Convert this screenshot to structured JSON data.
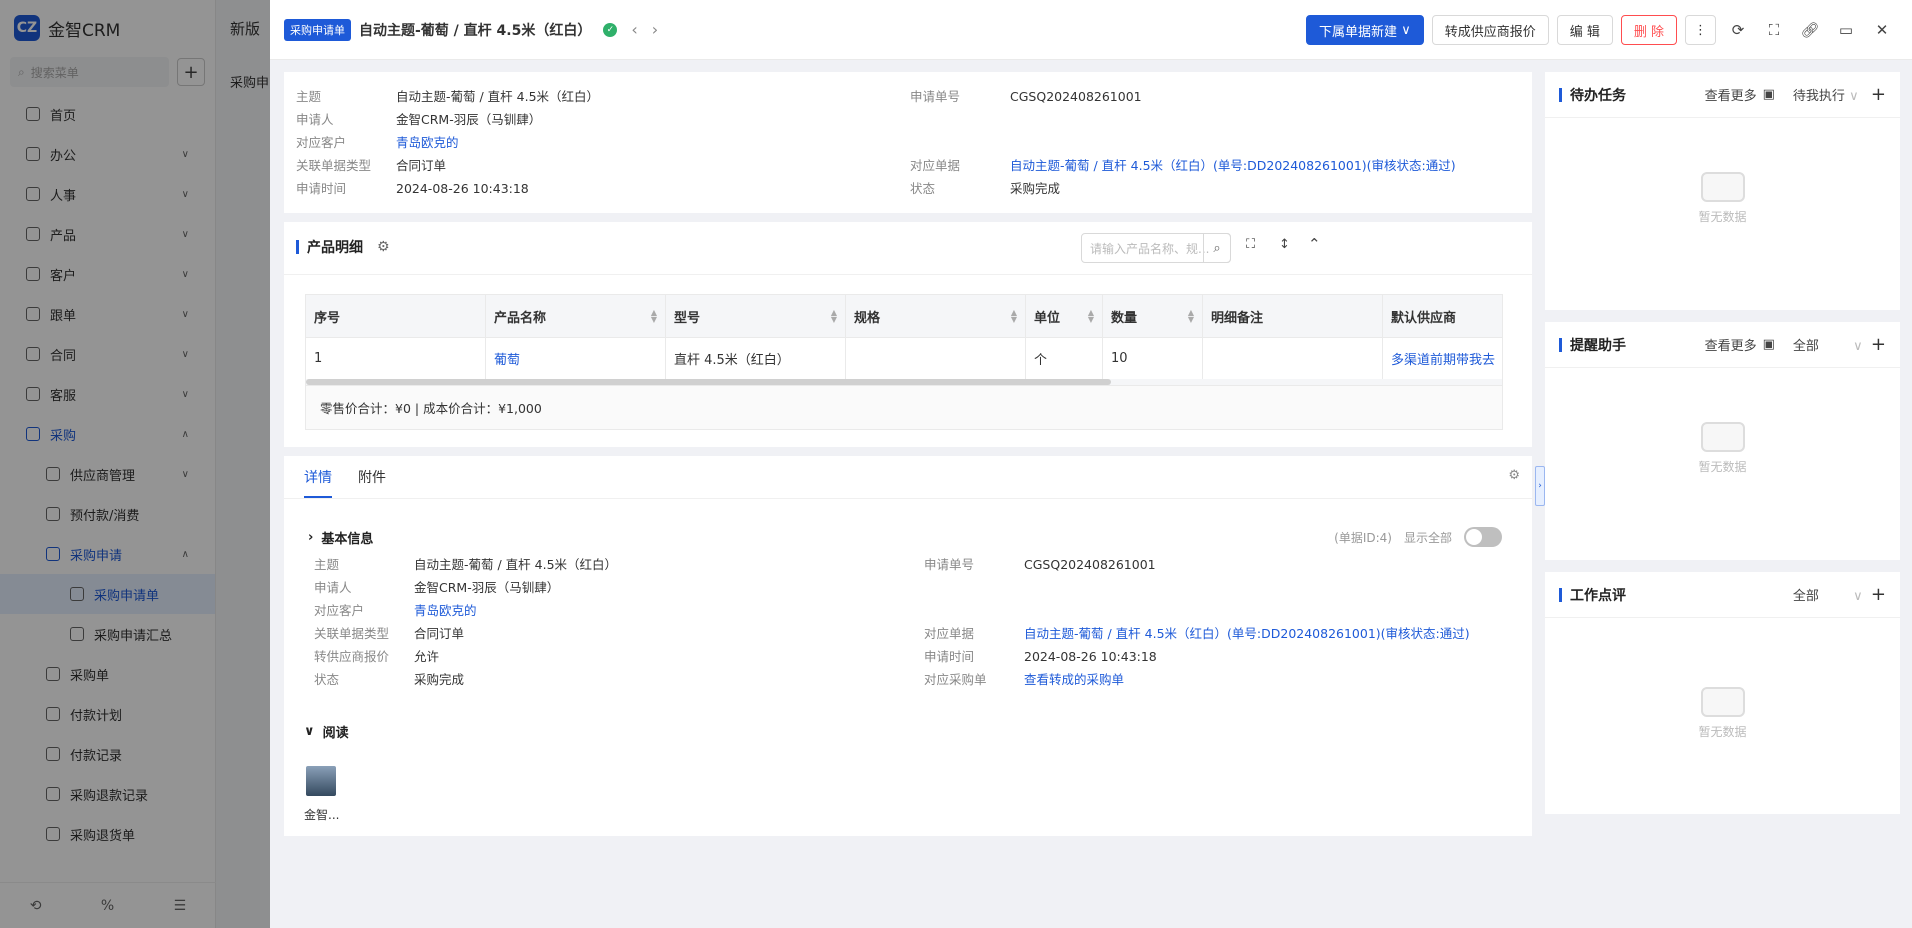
{
  "app": {
    "logo_text": "金智CRM",
    "logo_mark": "CZ",
    "search_placeholder": "搜索菜单",
    "mid_tab": "新版",
    "mid_sub": "采购申"
  },
  "menu": [
    {
      "label": "首页"
    },
    {
      "label": "办公"
    },
    {
      "label": "人事"
    },
    {
      "label": "产品"
    },
    {
      "label": "客户"
    },
    {
      "label": "跟单"
    },
    {
      "label": "合同"
    },
    {
      "label": "客服"
    },
    {
      "label": "采购"
    },
    {
      "label": "供应商管理"
    },
    {
      "label": "预付款/消费"
    },
    {
      "label": "采购申请"
    },
    {
      "label": "采购申请单"
    },
    {
      "label": "采购申请汇总"
    },
    {
      "label": "采购单"
    },
    {
      "label": "付款计划"
    },
    {
      "label": "付款记录"
    },
    {
      "label": "采购退款记录"
    },
    {
      "label": "采购退货单"
    }
  ],
  "topbar": {
    "badge": "采购申请单",
    "title": "自动主题-葡萄 / 直杆 4.5米（红白）",
    "btn_new": "下属单据新建",
    "btn_convert": "转成供应商报价",
    "btn_edit": "编 辑",
    "btn_delete": "删 除"
  },
  "summary": {
    "subject_k": "主题",
    "subject_v": "自动主题-葡萄 / 直杆 4.5米（红白）",
    "applicant_k": "申请人",
    "applicant_v": "金智CRM-羽辰（马钏肆）",
    "customer_k": "对应客户",
    "customer_v": "青岛欧克的",
    "reltype_k": "关联单据类型",
    "reltype_v": "合同订单",
    "time_k": "申请时间",
    "time_v": "2024-08-26 10:43:18",
    "no_k": "申请单号",
    "no_v": "CGSQ202408261001",
    "reldoc_k": "对应单据",
    "reldoc_v": "自动主题-葡萄 / 直杆 4.5米（红白）(单号:DD202408261001)(审核状态:通过)",
    "status_k": "状态",
    "status_v": "采购完成"
  },
  "products": {
    "title": "产品明细",
    "search_placeholder": "请输入产品名称、规...",
    "columns": [
      "序号",
      "产品名称",
      "型号",
      "规格",
      "单位",
      "数量",
      "明细备注",
      "默认供应商"
    ],
    "rows": [
      [
        "1",
        "葡萄",
        "直杆 4.5米（红白）",
        "",
        "个",
        "10",
        "",
        "多渠道前期带我去"
      ]
    ],
    "footer": "零售价合计：¥0 |   成本价合计：¥1,000"
  },
  "detail": {
    "tab_detail": "详情",
    "tab_attach": "附件",
    "basic_title": "基本信息",
    "doc_id": "(单据ID:4)",
    "show_all": "显示全部",
    "subject_k": "主题",
    "subject_v": "自动主题-葡萄 / 直杆 4.5米（红白）",
    "applicant_k": "申请人",
    "applicant_v": "金智CRM-羽辰（马钏肆）",
    "customer_k": "对应客户",
    "customer_v": "青岛欧克的",
    "reltype_k": "关联单据类型",
    "reltype_v": "合同订单",
    "quote_k": "转供应商报价",
    "quote_v": "允许",
    "status_k": "状态",
    "status_v": "采购完成",
    "no_k": "申请单号",
    "no_v": "CGSQ202408261001",
    "reldoc_k": "对应单据",
    "reldoc_v": "自动主题-葡萄 / 直杆 4.5米（红白）(单号:DD202408261001)(审核状态:通过)",
    "time_k": "申请时间",
    "time_v": "2024-08-26 10:43:18",
    "po_k": "对应采购单",
    "po_v": "查看转成的采购单",
    "read_title": "阅读",
    "reader": "金智..."
  },
  "right": {
    "todo_title": "待办任务",
    "todo_more": "查看更多",
    "todo_sel": "待我执行",
    "remind_title": "提醒助手",
    "remind_more": "查看更多",
    "remind_sel": "全部",
    "review_title": "工作点评",
    "review_sel": "全部",
    "empty": "暂无数据"
  }
}
